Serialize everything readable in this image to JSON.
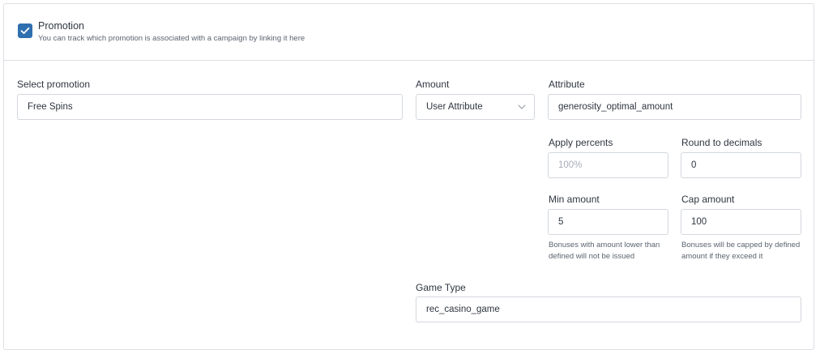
{
  "promotion": {
    "title": "Promotion",
    "subtitle": "You can track which promotion is associated with a campaign by linking it here",
    "checked": true
  },
  "select_promotion": {
    "label": "Select promotion",
    "value": "Free Spins"
  },
  "amount": {
    "label": "Amount",
    "value": "User Attribute"
  },
  "attribute": {
    "label": "Attribute",
    "value": "generosity_optimal_amount"
  },
  "apply_percents": {
    "label": "Apply percents",
    "placeholder": "100%"
  },
  "round_to_decimals": {
    "label": "Round to decimals",
    "value": "0"
  },
  "min_amount": {
    "label": "Min amount",
    "value": "5",
    "help": "Bonuses with amount lower than defined will not be issued"
  },
  "cap_amount": {
    "label": "Cap amount",
    "value": "100",
    "help": "Bonuses will be capped by defined amount if they exceed it"
  },
  "game_type": {
    "label": "Game Type",
    "value": "rec_casino_game"
  },
  "colors": {
    "accent": "#2f6fb0",
    "border": "#d3d7dd"
  }
}
